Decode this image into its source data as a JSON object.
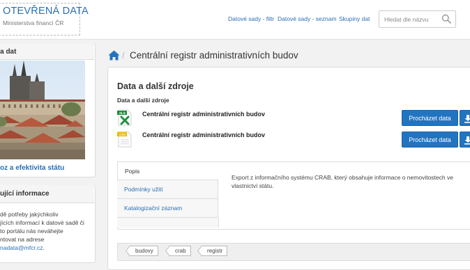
{
  "header": {
    "logo_title": "OTEVŘENÁ DATA",
    "logo_subtitle": "Ministerstva financí ČR",
    "nav": [
      "Datové sady - filtr",
      "Datové sady - seznam",
      "Skupiny dat"
    ],
    "search_placeholder": "Hledat dle názvu"
  },
  "sidebar": {
    "panel1_heading": "na dat",
    "panel1_link": "oz a efektivita státu",
    "panel2_heading": "ující informace",
    "info_lines": [
      "dě potřeby jakýchkoliv",
      "jících informací k datové sadě či",
      "to portálu nás neváhejte",
      "ntovat na adrese"
    ],
    "info_email": "nadata@mfcr.cz",
    "info_email_suffix": "."
  },
  "breadcrumb": {
    "separator": "/",
    "current": "Centrální registr administrativních budov"
  },
  "main": {
    "title": "Data a další zdroje",
    "subtitle": "Data a další zdroje",
    "resources": [
      {
        "name": "Centrální registr administrativních budov",
        "format": "XLS",
        "format_color": "#1e8e3e",
        "button": "Procházet data"
      },
      {
        "name": "Centrální registr administrativních budov",
        "format": "CSV",
        "format_color": "#f0b400",
        "button": "Procházet data"
      }
    ],
    "tabs": [
      "Popis",
      "Podmínky užití",
      "Katalogizační záznam"
    ],
    "description": "Export z informačního systému CRAB, který obsahuje informace o nemovitostech ve vlastnictví státu.",
    "tags": [
      "budovy",
      "crab",
      "registr"
    ]
  },
  "colors": {
    "accent": "#2274c1",
    "link": "#2a6fb3"
  }
}
